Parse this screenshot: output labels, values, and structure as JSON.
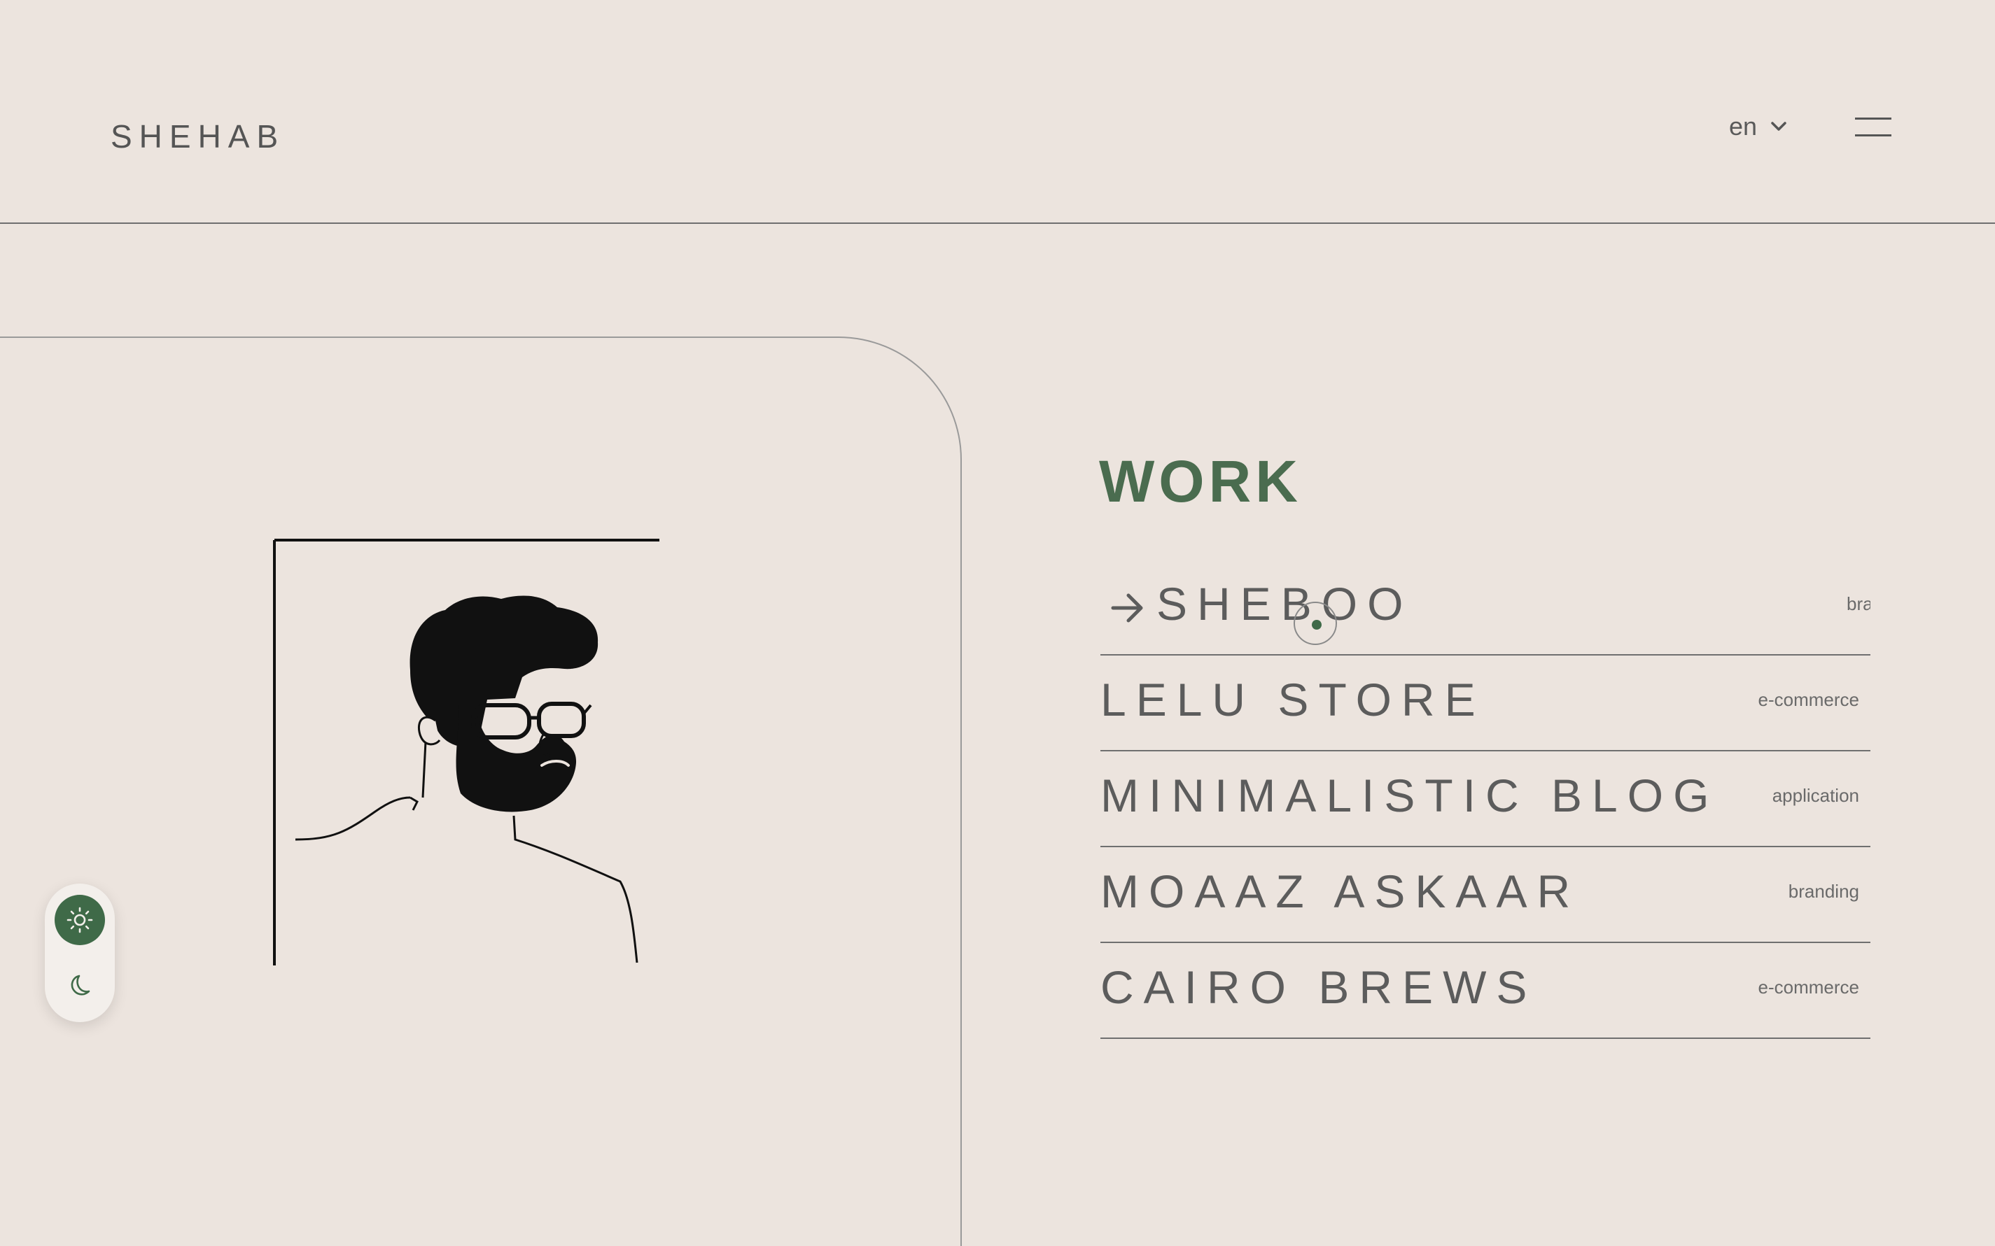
{
  "header": {
    "logo": "SHEHAB",
    "language": "en",
    "menu_icon": "hamburger-icon"
  },
  "theme_toggle": {
    "light_icon": "sun-icon",
    "dark_icon": "moon-icon",
    "active": "light"
  },
  "colors": {
    "background": "#ece4de",
    "accent": "#3f6a48",
    "text": "#5c5c5c"
  },
  "work": {
    "title": "WORK",
    "items": [
      {
        "name": "SHEBOO",
        "tag": "branding",
        "active": true
      },
      {
        "name": "LELU STORE",
        "tag": "e-commerce"
      },
      {
        "name": "MINIMALISTIC BLOG",
        "tag": "application"
      },
      {
        "name": "MOAAZ ASKAAR",
        "tag": "branding"
      },
      {
        "name": "CAIRO BREWS",
        "tag": "e-commerce"
      }
    ]
  }
}
